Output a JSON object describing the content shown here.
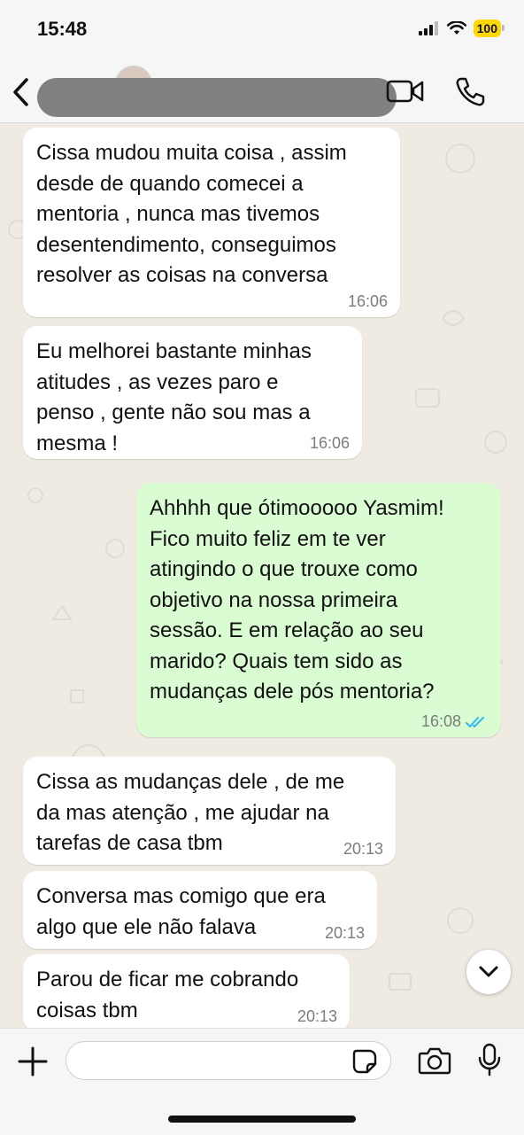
{
  "status_bar": {
    "time": "15:48",
    "battery": "100",
    "icons": [
      "cellular-signal-icon",
      "wifi-icon",
      "battery-icon"
    ]
  },
  "header": {
    "contact_name": "",
    "icons": [
      "back-chevron-icon",
      "video-call-icon",
      "phone-call-icon"
    ]
  },
  "messages": [
    {
      "direction": "incoming",
      "text": "Cissa mudou muita coisa , assim\ndesde de quando comecei a\nmentoria , nunca mas tivemos\ndesentendimento, conseguimos\nresolver as coisas na conversa",
      "time": "16:06"
    },
    {
      "direction": "incoming",
      "text": "Eu melhorei bastante minhas\natitudes , as vezes paro e\npenso , gente não sou mas a\nmesma !",
      "time": "16:06"
    },
    {
      "direction": "outgoing",
      "text": "Ahhhh que ótimooooo Yasmim!\nFico muito feliz em te ver\natingindo o que trouxe como\nobjetivo na nossa primeira\nsessão. E em relação ao seu\nmarido? Quais tem sido as\nmudanças dele pós mentoria?",
      "time": "16:08",
      "status": "read"
    },
    {
      "direction": "incoming",
      "text": "Cissa as mudanças dele , de me\nda mas atenção , me ajudar na\ntarefas de casa tbm",
      "time": "20:13"
    },
    {
      "direction": "incoming",
      "text": "Conversa mas comigo que era\nalgo que ele não falava",
      "time": "20:13"
    },
    {
      "direction": "incoming",
      "text": "Parou de ficar me cobrando\ncoisas tbm",
      "time": "20:13"
    }
  ],
  "composer": {
    "input_value": "",
    "icons": [
      "plus-icon",
      "sticker-icon",
      "camera-icon",
      "microphone-icon"
    ]
  },
  "colors": {
    "outgoing_bubble": "#dafcd2",
    "incoming_bubble": "#ffffff",
    "chat_background": "#efeae2",
    "read_tick": "#34b7f1",
    "battery": "#ffd60a"
  }
}
